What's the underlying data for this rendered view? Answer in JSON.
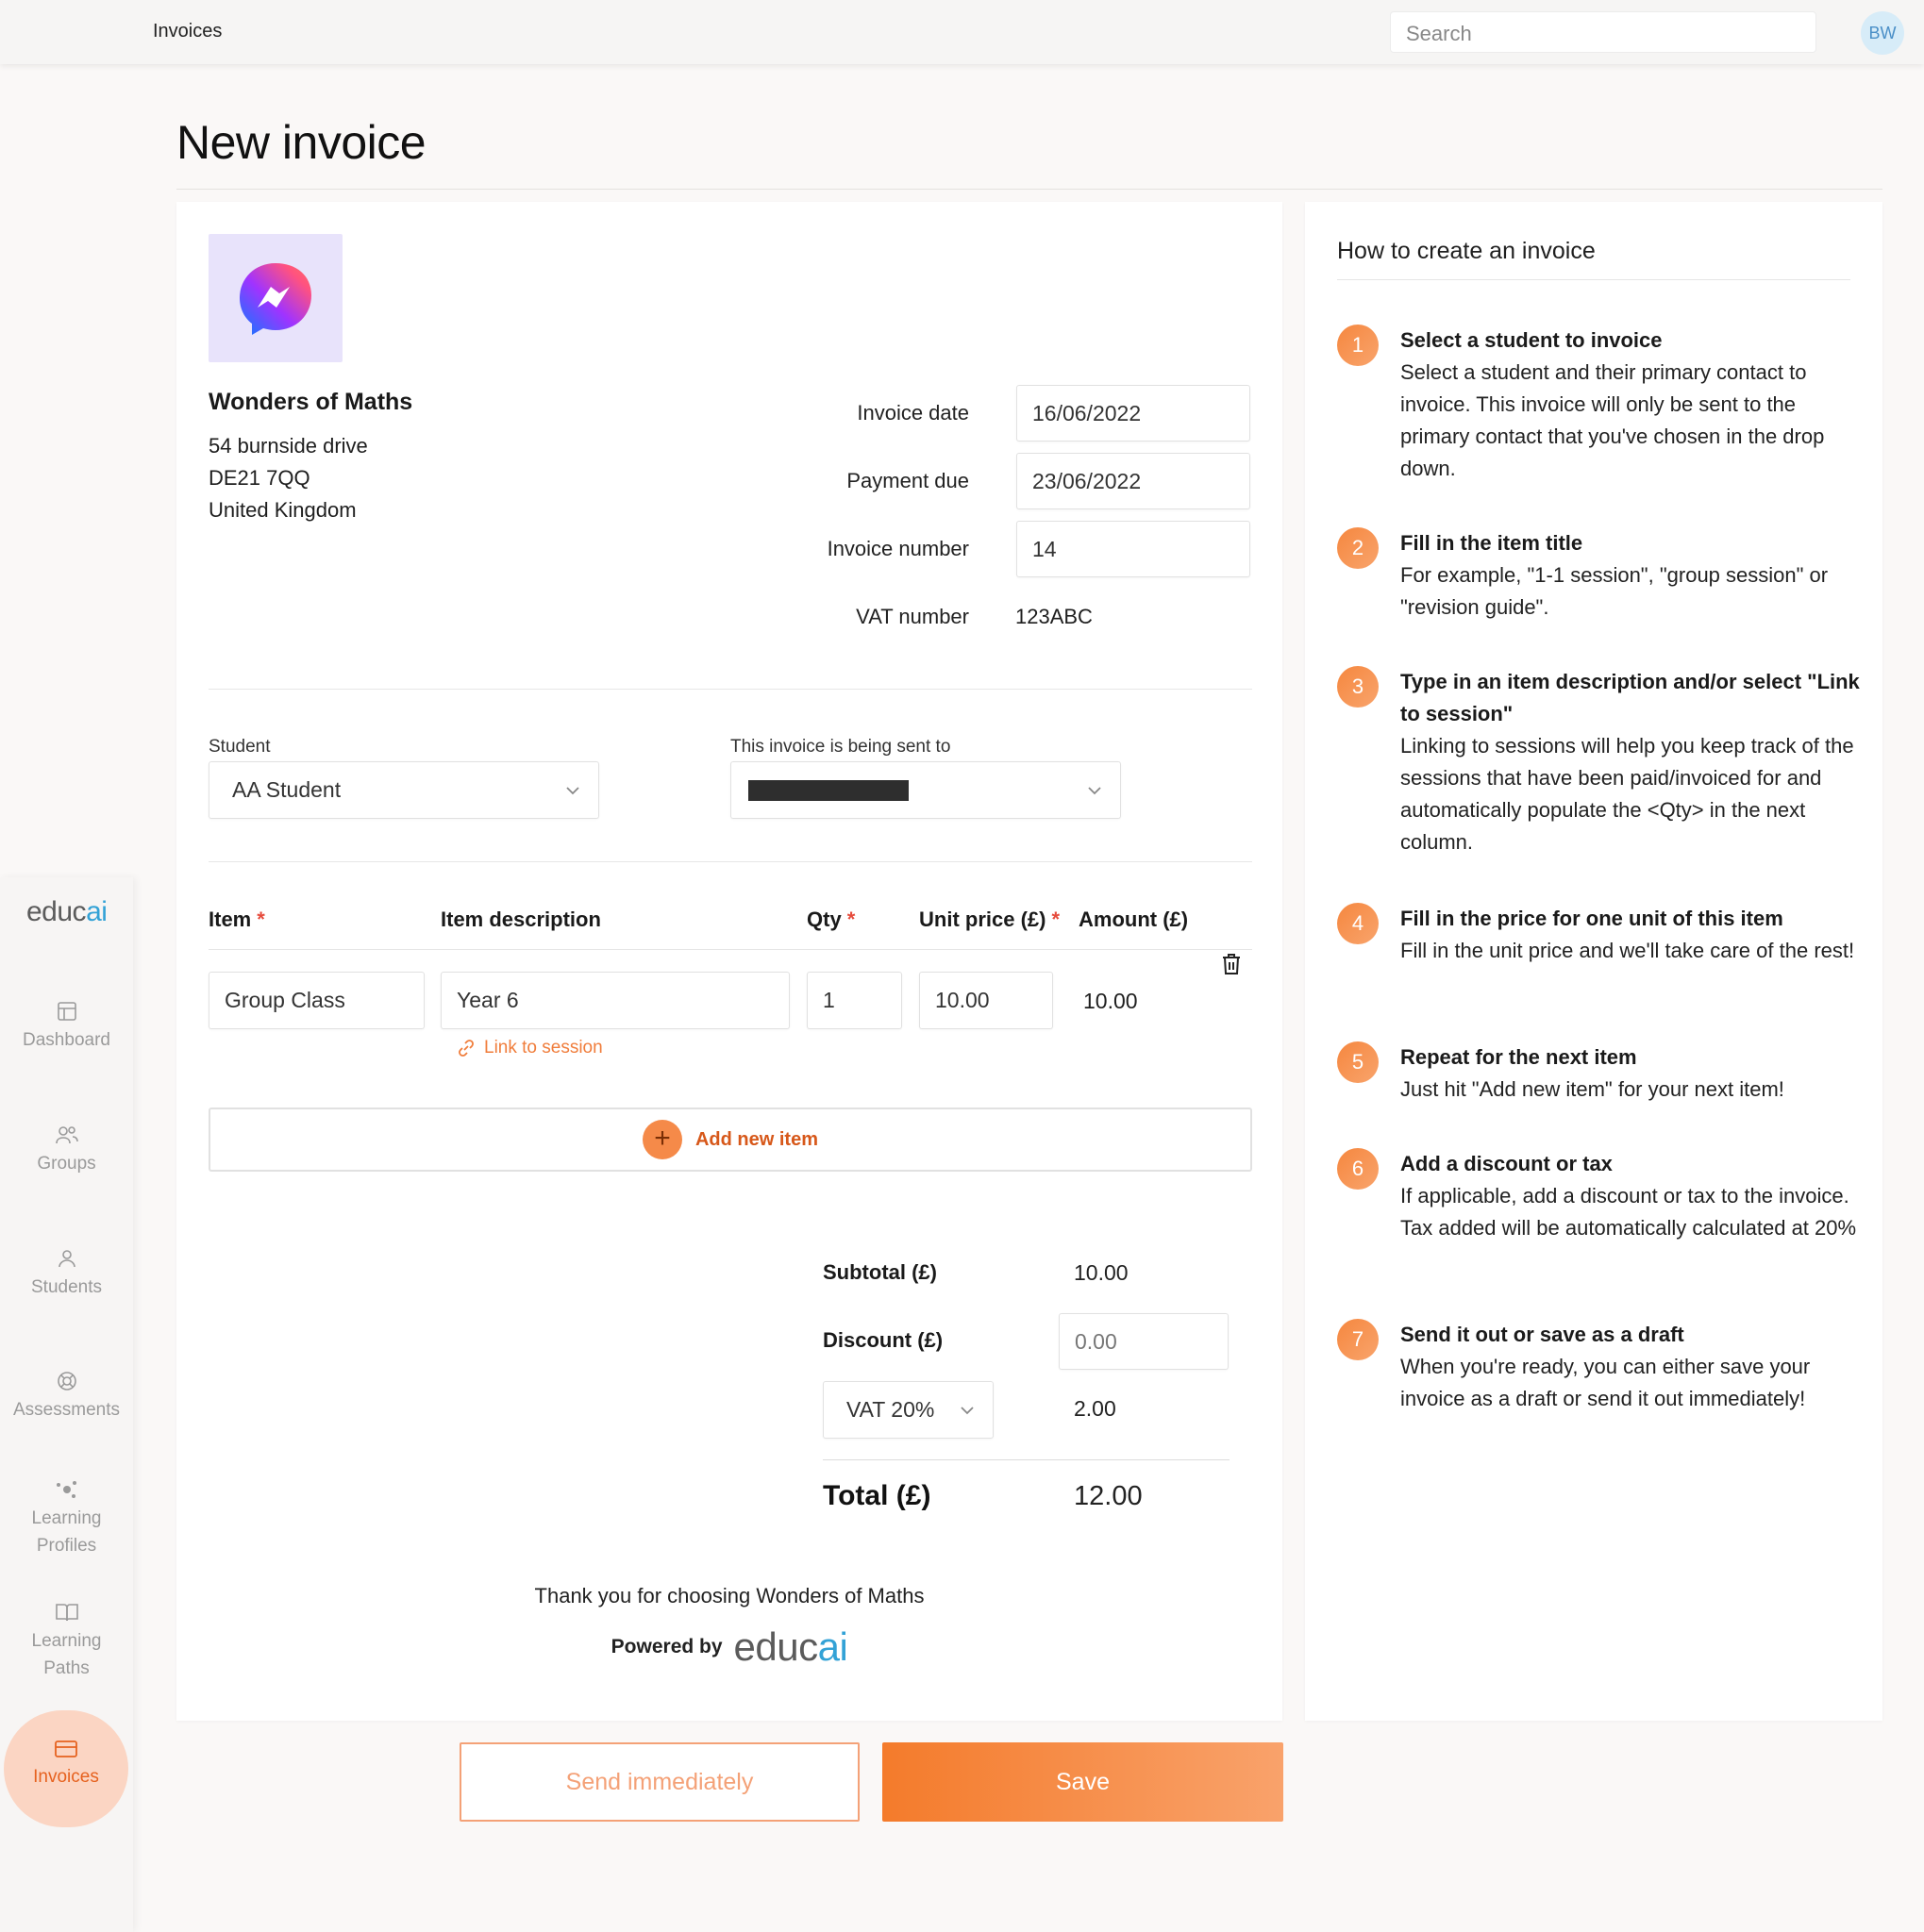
{
  "topbar": {
    "breadcrumb": "Invoices",
    "search_placeholder": "Search",
    "avatar_initials": "BW"
  },
  "brand": {
    "logo_edu": "educ",
    "logo_ai": "ai",
    "accent": "#f47b2b",
    "logo_blue": "#33a2d6"
  },
  "sidebar": {
    "items": [
      {
        "label": "Dashboard",
        "icon": "layout-icon"
      },
      {
        "label": "Groups",
        "icon": "users-icon"
      },
      {
        "label": "Students",
        "icon": "user-icon"
      },
      {
        "label": "Assessments",
        "icon": "lifebuoy-icon"
      },
      {
        "label": "Learning Profiles",
        "icon": "constellation-icon"
      },
      {
        "label": "Learning Paths",
        "icon": "book-icon"
      },
      {
        "label": "Invoices",
        "icon": "card-icon",
        "active": true
      }
    ]
  },
  "page": {
    "title": "New invoice"
  },
  "invoice": {
    "company_name": "Wonders of Maths",
    "address_line1": "54 burnside drive",
    "address_line2": "DE21 7QQ",
    "address_line3": "United Kingdom",
    "invoice_date_label": "Invoice date",
    "invoice_date": "16/06/2022",
    "payment_due_label": "Payment due",
    "payment_due": "23/06/2022",
    "invoice_number_label": "Invoice number",
    "invoice_number": "14",
    "vat_number_label": "VAT number",
    "vat_number": "123ABC",
    "student_label": "Student",
    "student_value": "AA Student",
    "sent_to_label": "This invoice is being sent to",
    "columns": {
      "item": "Item",
      "description": "Item description",
      "qty": "Qty",
      "unit_price": "Unit price (£)",
      "amount": "Amount (£)",
      "required_mark": "*"
    },
    "line_items": [
      {
        "item": "Group Class",
        "description": "Year 6",
        "qty": "1",
        "unit_price": "10.00",
        "amount": "10.00"
      }
    ],
    "link_to_session": "Link to session",
    "add_new_item": "Add new item",
    "subtotal_label": "Subtotal (£)",
    "subtotal": "10.00",
    "discount_label": "Discount (£)",
    "discount_placeholder": "0.00",
    "vat_select": "VAT 20%",
    "vat_amount": "2.00",
    "total_label": "Total (£)",
    "total": "12.00",
    "thanks": "Thank you for choosing Wonders of Maths",
    "powered_by": "Powered by"
  },
  "help": {
    "title": "How to create an invoice",
    "steps": [
      {
        "num": "1",
        "title": "Select a student to invoice",
        "desc": "Select a student and their primary contact to invoice. This invoice will only be sent to the primary contact that you've chosen in the drop down."
      },
      {
        "num": "2",
        "title": "Fill in the item title",
        "desc": "For example, \"1-1 session\", \"group session\" or \"revision guide\"."
      },
      {
        "num": "3",
        "title": "Type in an item description and/or select \"Link to session\"",
        "desc": "Linking to sessions will help you keep track of the sessions that have been paid/invoiced for and automatically populate the <Qty> in the next column."
      },
      {
        "num": "4",
        "title": "Fill in the price for one unit of this item",
        "desc": "Fill in the unit price and we'll take care of the rest!"
      },
      {
        "num": "5",
        "title": "Repeat for the next item",
        "desc": "Just hit \"Add new item\" for your next item!"
      },
      {
        "num": "6",
        "title": "Add a discount or tax",
        "desc": "If applicable, add a discount or tax to the invoice. Tax added will be automatically calculated at 20%"
      },
      {
        "num": "7",
        "title": "Send it out or save as a draft",
        "desc": "When you're ready, you can either save your invoice as a draft or send it out immediately!"
      }
    ]
  },
  "actions": {
    "send": "Send immediately",
    "save": "Save"
  }
}
